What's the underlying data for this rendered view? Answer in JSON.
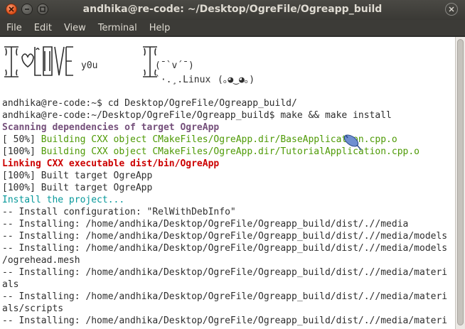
{
  "window": {
    "title": "andhika@re-code: ~/Desktop/OgreFile/Ogreapp_build"
  },
  "menu": [
    "File",
    "Edit",
    "View",
    "Terminal",
    "Help"
  ],
  "banner": {
    "you": "y0u",
    "face": "(¯`v´¯)",
    "linux": "`·.¸.Linux",
    "smiley": "(｡◕‿◕｡)"
  },
  "terminal": {
    "lines": [
      {
        "text": "andhika@re-code:~$ cd Desktop/OgreFile/Ogreapp_build/",
        "style": "plain"
      },
      {
        "text": "andhika@re-code:~/Desktop/OgreFile/Ogreapp_build$ make && make install",
        "style": "plain"
      },
      {
        "text": "Scanning dependencies of target OgreApp",
        "style": "purple"
      },
      {
        "prefix": "[ 50%] ",
        "text": "Building CXX object CMakeFiles/OgreApp.dir/BaseApplication.cpp.o",
        "style": "green"
      },
      {
        "prefix": "[100%] ",
        "text": "Building CXX object CMakeFiles/OgreApp.dir/TutorialApplication.cpp.o",
        "style": "green"
      },
      {
        "text": "Linking CXX executable dist/bin/OgreApp",
        "style": "red"
      },
      {
        "text": "[100%] Built target OgreApp",
        "style": "plain"
      },
      {
        "text": "[100%] Built target OgreApp",
        "style": "plain"
      },
      {
        "text": "Install the project...",
        "style": "teal"
      },
      {
        "text": "-- Install configuration: \"RelWithDebInfo\"",
        "style": "plain"
      },
      {
        "text": "-- Installing: /home/andhika/Desktop/OgreFile/Ogreapp_build/dist/.//media",
        "style": "plain"
      },
      {
        "text": "-- Installing: /home/andhika/Desktop/OgreFile/Ogreapp_build/dist/.//media/models",
        "style": "plain"
      },
      {
        "text": "-- Installing: /home/andhika/Desktop/OgreFile/Ogreapp_build/dist/.//media/models",
        "style": "plain"
      },
      {
        "text": "/ogrehead.mesh",
        "style": "plain"
      },
      {
        "text": "-- Installing: /home/andhika/Desktop/OgreFile/Ogreapp_build/dist/.//media/materi",
        "style": "plain"
      },
      {
        "text": "als",
        "style": "plain"
      },
      {
        "text": "-- Installing: /home/andhika/Desktop/OgreFile/Ogreapp_build/dist/.//media/materi",
        "style": "plain"
      },
      {
        "text": "als/scripts",
        "style": "plain"
      },
      {
        "text": "-- Installing: /home/andhika/Desktop/OgreFile/Ogreapp_build/dist/.//media/materi",
        "style": "plain"
      }
    ]
  },
  "colors": {
    "green": "#4e9a06",
    "purple": "#75507b",
    "red": "#cc0000",
    "teal": "#06989a",
    "close": "#e2561f"
  }
}
